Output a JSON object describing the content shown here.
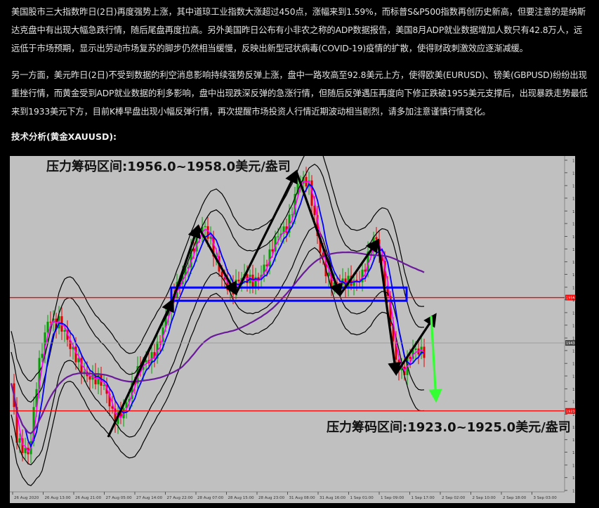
{
  "article": {
    "paragraph1": "美国股市三大指数昨日(2日)再度强势上涨，其中道琼工业指数大涨超过450点，涨幅来到1.59%，而标普S&P500指数再创历史新高，但要注意的是纳斯达克盘中有出现大幅急跌行情，随后尾盘再度拉高。另外美国昨日公布有小非农之称的ADP数据报告，美国8月ADP就业数据增加人数只有42.8万人，远远低于市场预期，显示出劳动市场复苏的脚步仍然相当缓慢，反映出新型冠状病毒(COVID-19)疫情的扩散，使得财政刺激效应逐渐减缓。",
    "paragraph2": "另一方面，美元昨日(2日)不受到数据的利空消息影响持续强势反弹上涨，盘中一路攻高至92.8美元上方，使得欧美(EURUSD)、镑美(GBPUSD)纷纷出现重挫行情，而黄金受到ADP就业数据的利多影响，盘中出现跌深反弹的急涨行情，但随后反弹遇压再度向下修正跌破1955美元支撑后，出现暴跌走势最低来到1933美元下方，目前K棒早盘出现小幅反弹行情，再次提醒市场投资人行情近期波动相当剧烈，请多加注意谨慎行情变化。",
    "heading": "技术分析(黄金XAUUSD):"
  },
  "chart_data": {
    "type": "candlestick",
    "symbol": "XAUUSD",
    "annotation_top": "压力筹码区间:1956.0~1958.0美元/盎司",
    "annotation_bottom": "压力筹码区间:1923.0~1925.0美元/盎司",
    "price_axis_ticks": [
      "1995.60",
      "1992.00",
      "1988.30",
      "1984.70",
      "1981.00",
      "1977.40",
      "1973.70",
      "1970.10",
      "1966.40",
      "1962.80",
      "1959.10",
      "1955.50",
      "1951.80",
      "1948.20",
      "1944.50",
      "1940.90",
      "1937.20",
      "1933.60",
      "1929.90",
      "1926.30",
      "1922.60",
      "1919.00",
      "1915.30",
      "1911.70",
      "1908.00",
      "1904.40",
      "1900.70"
    ],
    "time_axis_labels": [
      "26 Aug 2020",
      "26 Aug 13:00",
      "26 Aug 21:00",
      "27 Aug 05:00",
      "27 Aug 14:00",
      "27 Aug 22:00",
      "28 Aug 07:00",
      "28 Aug 15:00",
      "28 Aug 23:00",
      "31 Aug 08:00",
      "31 Aug 16:00",
      "1 Sep 01:00",
      "1 Sep 09:00",
      "1 Sep 17:00",
      "2 Sep 02:00",
      "2 Sep 10:00",
      "2 Sep 18:00",
      "3 Sep 03:00"
    ],
    "resistance_line_price": "1956.12",
    "support_line_price": "1923.56",
    "current_price": "1943.09",
    "colors": {
      "background": "#c0c0c0",
      "resistance_line": "#ff0000",
      "blue_box": "#0000ff",
      "ma_fast": "#ff00ff",
      "ma_slow": "#0000ff",
      "ma_long": "#6a1a9a",
      "bands": "#000000",
      "candle_up": "#00a000",
      "candle_down": "#e00000",
      "arrow": "#000000",
      "forecast_arrow": "#33ff33"
    }
  }
}
